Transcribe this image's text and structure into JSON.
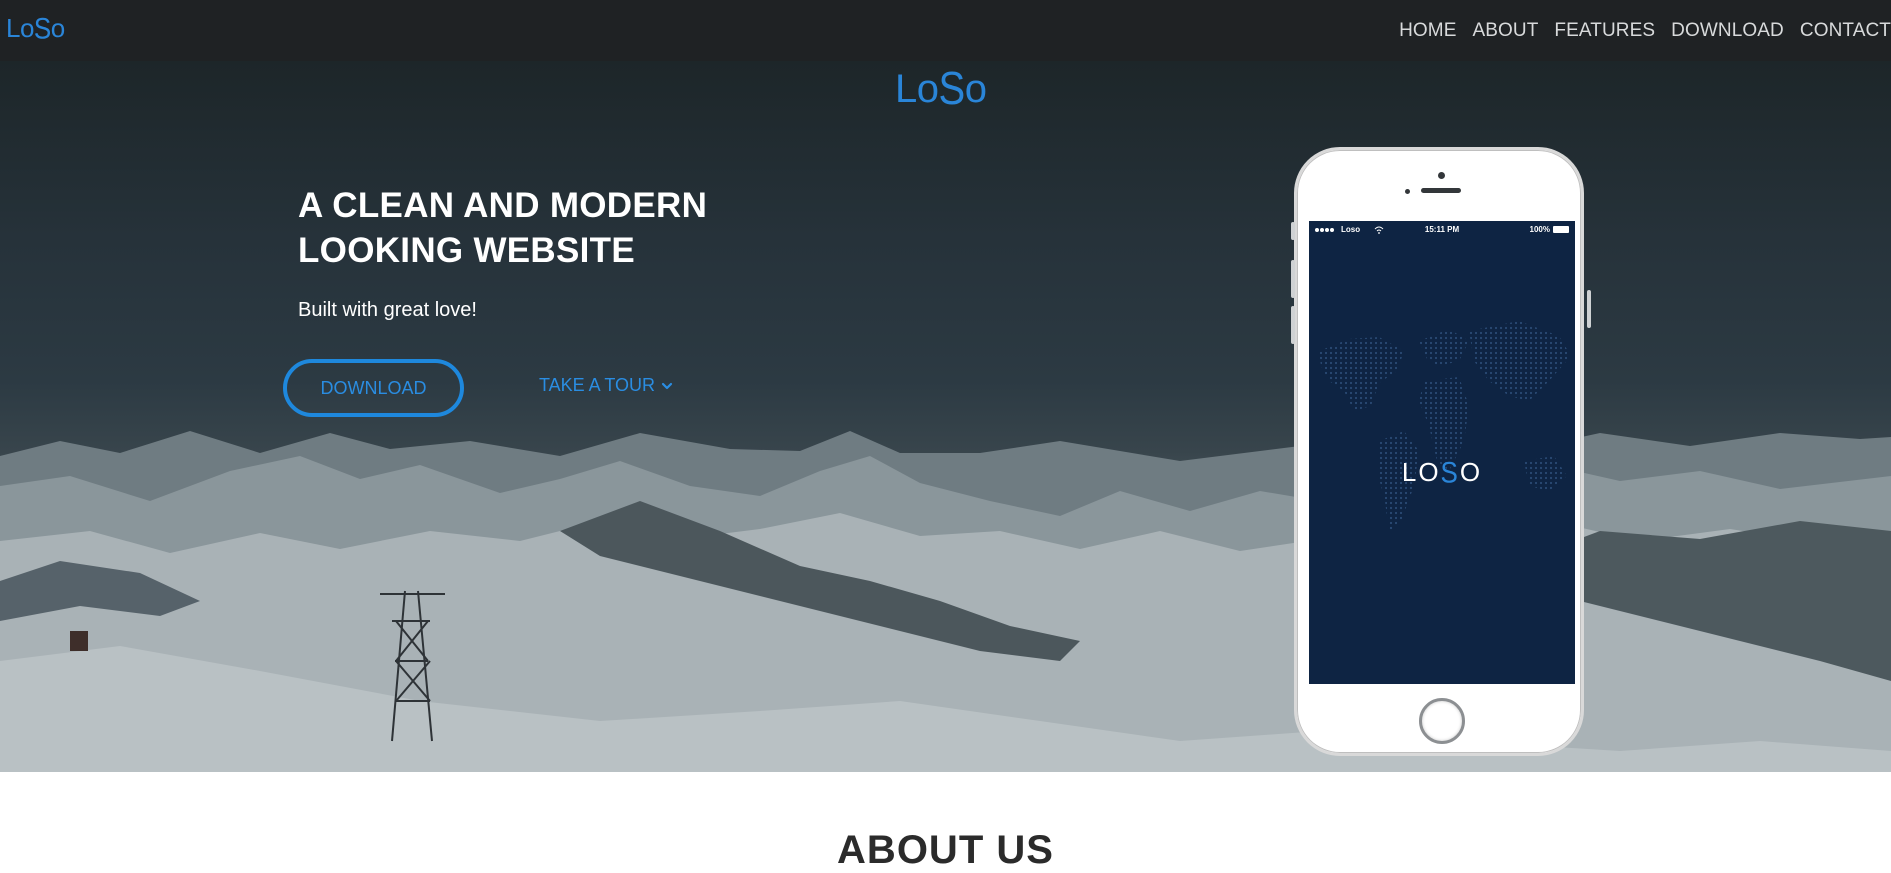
{
  "nav": {
    "logo": {
      "prefix": "Lo",
      "mark": "S",
      "suffix": "o"
    },
    "links": [
      "HOME",
      "ABOUT",
      "FEATURES",
      "DOWNLOAD",
      "CONTACT"
    ]
  },
  "hero": {
    "logo": {
      "prefix": "Lo",
      "mark": "S",
      "suffix": "o"
    },
    "title_line1": "A CLEAN AND MODERN",
    "title_line2": "LOOKING WEBSITE",
    "subtitle": "Built with great love!",
    "download_label": "DOWNLOAD",
    "tour_label": "TAKE A TOUR",
    "tour_icon": "chevron-down-icon"
  },
  "phone": {
    "status": {
      "carrier": "Loso",
      "time": "15:11 PM",
      "battery": "100%"
    },
    "screen_logo": {
      "prefix": "LO",
      "mark": "S",
      "suffix": "O"
    }
  },
  "about": {
    "heading": "ABOUT US"
  },
  "colors": {
    "accent": "#2a85d8",
    "navbar": "#1f2224",
    "phone_screen": "#0e2443"
  }
}
